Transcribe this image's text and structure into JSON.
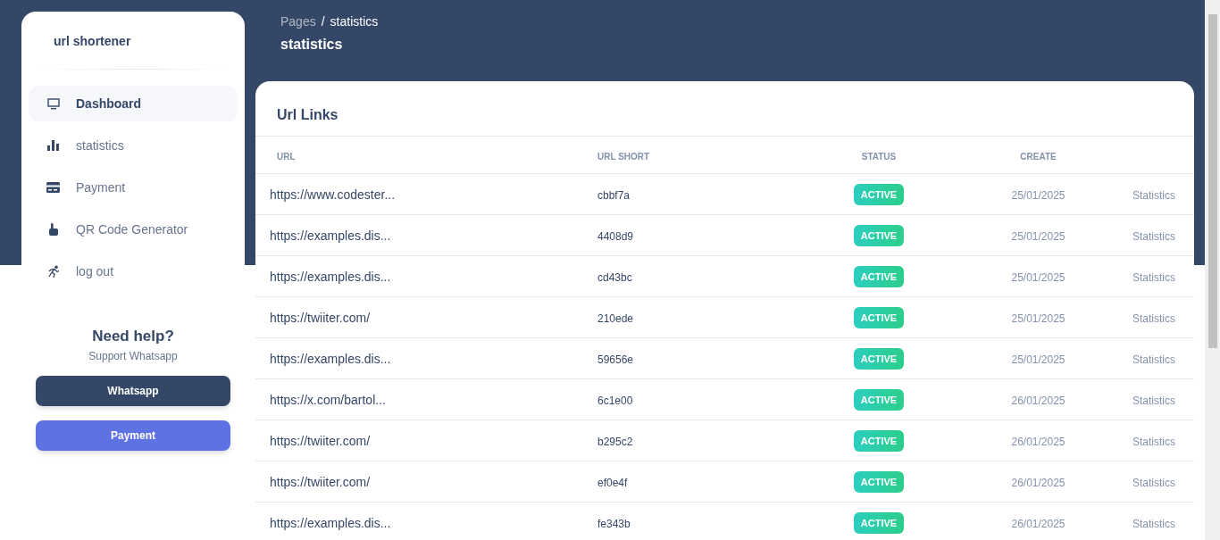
{
  "sidebar": {
    "brand": "url shortener",
    "items": [
      {
        "label": "Dashboard",
        "selected": true
      },
      {
        "label": "statistics",
        "selected": false
      },
      {
        "label": "Payment",
        "selected": false
      },
      {
        "label": "QR Code Generator",
        "selected": false
      },
      {
        "label": "log out",
        "selected": false
      }
    ],
    "help": {
      "title": "Need help?",
      "subtitle": "Support Whatsapp",
      "buttons": [
        {
          "label": "Whatsapp",
          "kind": "dark"
        },
        {
          "label": "Payment",
          "kind": "primary"
        }
      ]
    }
  },
  "breadcrumb": {
    "parent": "Pages",
    "separator": "/",
    "current": "statistics"
  },
  "page_title": "statistics",
  "table": {
    "title": "Url Links",
    "columns": [
      "URL",
      "URL SHORT",
      "STATUS",
      "CREATE"
    ],
    "rows": [
      {
        "url": "https://www.codester...",
        "short": "cbbf7a",
        "status": "ACTIVE",
        "created": "25/01/2025",
        "link": "Statistics"
      },
      {
        "url": "https://examples.dis...",
        "short": "4408d9",
        "status": "ACTIVE",
        "created": "25/01/2025",
        "link": "Statistics"
      },
      {
        "url": "https://examples.dis...",
        "short": "cd43bc",
        "status": "ACTIVE",
        "created": "25/01/2025",
        "link": "Statistics"
      },
      {
        "url": "https://twiiter.com/",
        "short": "210ede",
        "status": "ACTIVE",
        "created": "25/01/2025",
        "link": "Statistics"
      },
      {
        "url": "https://examples.dis...",
        "short": "59656e",
        "status": "ACTIVE",
        "created": "25/01/2025",
        "link": "Statistics"
      },
      {
        "url": "https://x.com/bartol...",
        "short": "6c1e00",
        "status": "ACTIVE",
        "created": "26/01/2025",
        "link": "Statistics"
      },
      {
        "url": "https://twiiter.com/",
        "short": "b295c2",
        "status": "ACTIVE",
        "created": "26/01/2025",
        "link": "Statistics"
      },
      {
        "url": "https://twiiter.com/",
        "short": "ef0e4f",
        "status": "ACTIVE",
        "created": "26/01/2025",
        "link": "Statistics"
      },
      {
        "url": "https://examples.dis...",
        "short": "fe343b",
        "status": "ACTIVE",
        "created": "26/01/2025",
        "link": "Statistics"
      }
    ]
  }
}
